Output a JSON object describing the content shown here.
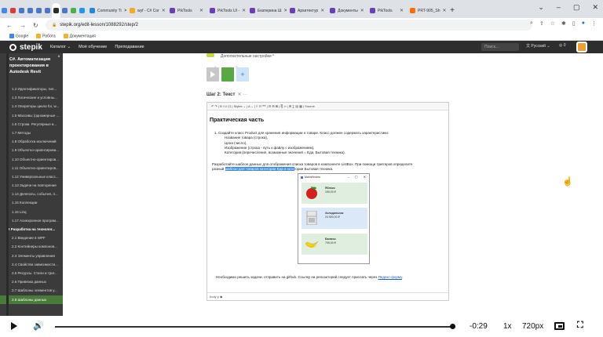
{
  "browser": {
    "tabs": [
      {
        "label": "",
        "color": "#4285f4",
        "small": true
      },
      {
        "label": "",
        "color": "#e53935",
        "small": true
      },
      {
        "label": "",
        "color": "#4a77c9",
        "small": true
      },
      {
        "label": "",
        "color": "#4a77c9",
        "small": true
      },
      {
        "label": "",
        "color": "#4a77c9",
        "small": true
      },
      {
        "label": "",
        "color": "#4a77c9",
        "small": true
      },
      {
        "label": "",
        "color": "#2e2e2e",
        "small": true,
        "active": true
      },
      {
        "label": "",
        "color": "#4a77c9",
        "small": true
      },
      {
        "label": "",
        "color": "#4caf50",
        "small": true
      },
      {
        "label": "",
        "color": "#2196f3",
        "small": true
      },
      {
        "label": "Community Ti",
        "color": "#1e88e5"
      },
      {
        "label": "wyf - C# Cor",
        "color": "#f9a825"
      },
      {
        "label": "PikTools",
        "color": "#6a3cc0"
      },
      {
        "label": "PikTools UI -",
        "color": "#6a3cc0"
      },
      {
        "label": "Екатерина Ш",
        "color": "#6a3cc0"
      },
      {
        "label": "Архитектур",
        "color": "#6a3cc0"
      },
      {
        "label": "Документы",
        "color": "#6a3cc0"
      },
      {
        "label": "PikTools",
        "color": "#6a3cc0"
      },
      {
        "label": "PRT-905_Sh",
        "color": "#ff6d00"
      }
    ],
    "new_tab": "+",
    "window_controls": [
      "⌄",
      "–",
      "▢",
      "✕"
    ],
    "url": "stepik.org/edit-lesson/1088292/step/2",
    "bookmarks": [
      {
        "label": "Google",
        "color": "#4285f4"
      },
      {
        "label": "Работа",
        "color": "#f0b429"
      },
      {
        "label": "Документация",
        "color": "#f0b429"
      }
    ]
  },
  "topbar": {
    "brand": "stepik",
    "menu": [
      "Каталог ⌄",
      "Моё обучение",
      "Преподавание"
    ],
    "search_placeholder": "Поиск...",
    "lang": "Русский ⌄",
    "points": "0"
  },
  "sidebar": {
    "course_number": "8",
    "course_title": "C#. Автоматизация проектирования в Autodesk Revit",
    "items": [
      {
        "label": "1.2 Идентификаторы, тип...",
        "type": "item"
      },
      {
        "label": "1.3 Логические и условны...",
        "type": "item"
      },
      {
        "label": "1.4 Операторы цикла for, w...",
        "type": "item"
      },
      {
        "label": "1.5 Массивы (одномерные ...",
        "type": "item"
      },
      {
        "label": "1.6 Строки. Регулярные в...",
        "type": "item"
      },
      {
        "label": "1.7 Методы",
        "type": "item"
      },
      {
        "label": "1.8 Обработка исключений",
        "type": "item"
      },
      {
        "label": "1.9 Объектно-ориентирова...",
        "type": "item"
      },
      {
        "label": "1.10 Объектно-ориентиров...",
        "type": "item"
      },
      {
        "label": "1.11 Объектно-ориентиров...",
        "type": "item"
      },
      {
        "label": "1.12 Универсальные класс...",
        "type": "item"
      },
      {
        "label": "1.13 Задачи на повторение",
        "type": "item"
      },
      {
        "label": "1.14 Делегаты, события, л...",
        "type": "item"
      },
      {
        "label": "1.15 Коллекции",
        "type": "item"
      },
      {
        "label": "1.16 Linq",
        "type": "item"
      },
      {
        "label": "1.17 Асинхронное програм...",
        "type": "item"
      },
      {
        "label": "2 Разработка на технолог...",
        "type": "sect"
      },
      {
        "label": "2.1 Введение в WPF",
        "type": "item"
      },
      {
        "label": "2.2 Контейнеры компонов...",
        "type": "item"
      },
      {
        "label": "2.3 Элементы управления",
        "type": "item"
      },
      {
        "label": "2.4 Свойства зависимости...",
        "type": "item"
      },
      {
        "label": "2.5 Ресурсы. Стили и триг...",
        "type": "item"
      },
      {
        "label": "2.6 Привязка данных",
        "type": "item"
      },
      {
        "label": "2.7 Шаблоны элементов у...",
        "type": "item"
      },
      {
        "label": "2.8 Шаблоны данных",
        "type": "hl"
      }
    ]
  },
  "step": {
    "settings_label": "Дополнительные настройки ^",
    "step_numbers": "1 2",
    "add_label": "+",
    "title": "Шаг 2: Текст",
    "title_extra": "✕ ···"
  },
  "editor": {
    "toolbar": "↶  ↷  |  B  I  U  ⟨/⟩  |  Styles ⌄  |  A ⌄  |  ≡  ☷  ❝❝  |  ⊟  ⊞  ⊠  |  ⎘  ∞  |  ⊞  ∑  ▤  ▦  |  Source",
    "heading": "Практическая часть",
    "list": [
      {
        "text": "1. Создайте класс Product для хранения информации о товаре. Класс должен содержать характеристики:",
        "level": 1
      },
      {
        "text": "Название товара (строка),",
        "level": 2
      },
      {
        "text": "Цена (число),",
        "level": 2
      },
      {
        "text": "Изображение (строка - путь к файлу с изображением),",
        "level": 2
      },
      {
        "text": "Категория (перечисление, возможные значения = Еда, Бытовая техника).",
        "level": 2
      }
    ],
    "para_line1": "Разработайте шаблон данных для отображения списка товаров в компоненте ListBox. При помощи триггеров определите",
    "para_pre": "разный ",
    "para_selected": "шаблон для товаров категории Еда и кате",
    "para_post": "гории Бытовая техника.",
    "foot_text": "Необходимо решить задачи, отправить на github. Ссылку на репозиторий следует прислать через ",
    "foot_link": "Яндекс-форму",
    "foot_end": ".",
    "status": "body  p  ◆"
  },
  "mockwindow": {
    "title": "MainWindow",
    "controls": [
      "–",
      "▢",
      "✕"
    ],
    "cards": [
      {
        "name": "Яблоко",
        "price": "159,00 ₽",
        "bg": "#dfeede",
        "kind": "apple"
      },
      {
        "name": "Холодильник",
        "price": "24 900,00 ₽",
        "bg": "#dbe8f7",
        "kind": "fridge"
      },
      {
        "name": "Бананы",
        "price": "799,00 ₽",
        "bg": "#dfeede",
        "kind": "banana"
      }
    ]
  },
  "video": {
    "time": "-0:29",
    "speed": "1x",
    "quality": "720px",
    "progress": 0.994
  }
}
